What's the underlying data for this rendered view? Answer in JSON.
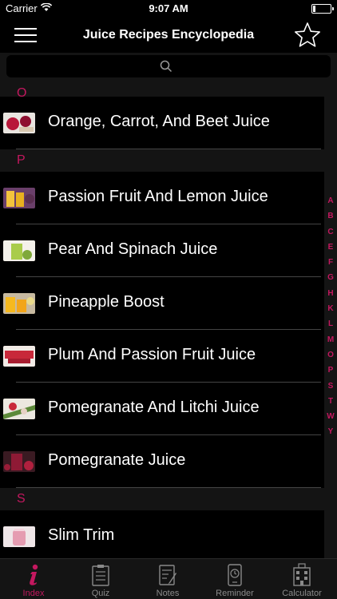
{
  "status_bar": {
    "carrier": "Carrier",
    "time": "9:07 AM"
  },
  "nav": {
    "title": "Juice Recipes Encyclopedia"
  },
  "search": {
    "placeholder": ""
  },
  "sections": [
    {
      "letter": "O",
      "items": [
        {
          "label": "Orange, Carrot, And Beet Juice"
        }
      ]
    },
    {
      "letter": "P",
      "items": [
        {
          "label": "Passion Fruit And Lemon Juice"
        },
        {
          "label": "Pear And Spinach Juice"
        },
        {
          "label": "Pineapple Boost"
        },
        {
          "label": "Plum And Passion Fruit Juice"
        },
        {
          "label": "Pomegranate And Litchi Juice"
        },
        {
          "label": "Pomegranate Juice"
        }
      ]
    },
    {
      "letter": "S",
      "items": [
        {
          "label": "Slim Trim"
        }
      ]
    }
  ],
  "index_letters": [
    "A",
    "B",
    "C",
    "E",
    "F",
    "G",
    "H",
    "K",
    "L",
    "M",
    "O",
    "P",
    "S",
    "T",
    "W",
    "Y"
  ],
  "tabs": [
    {
      "label": "Index",
      "icon": "info-icon",
      "active": true
    },
    {
      "label": "Quiz",
      "icon": "clipboard-icon",
      "active": false
    },
    {
      "label": "Notes",
      "icon": "notes-icon",
      "active": false
    },
    {
      "label": "Reminder",
      "icon": "reminder-icon",
      "active": false
    },
    {
      "label": "Calculator",
      "icon": "calculator-icon",
      "active": false
    }
  ],
  "colors": {
    "accent": "#c4185f",
    "background": "#141414",
    "row": "#000000"
  }
}
